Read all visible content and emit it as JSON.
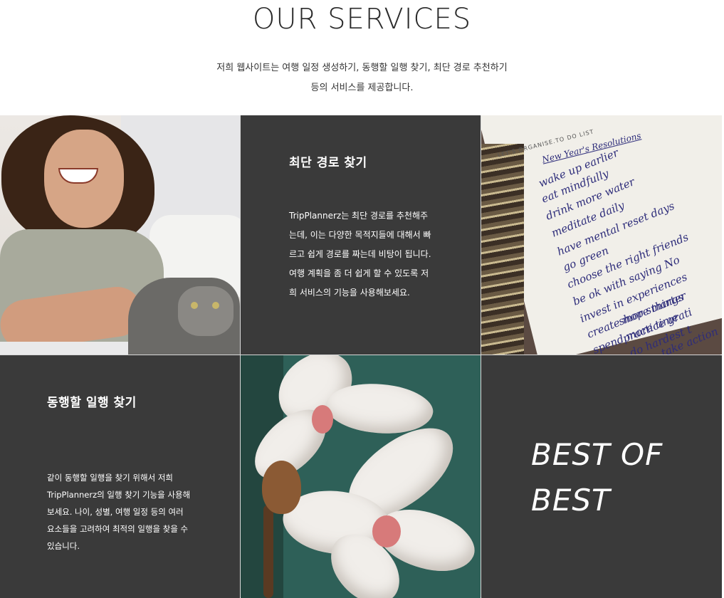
{
  "header": {
    "title": "OUR SERVICES",
    "subtitle": "저희 웹사이트는 여행 일정 생성하기, 동행할 일행 찾기, 최단 경로 추천하기 등의 서비스를 제공합니다."
  },
  "services": [
    {
      "title": "최단 경로 찾기",
      "body": "TripPlannerz는 최단 경로를 추천해주는데, 이는 다양한 목적지들에 대해서 빠르고 쉽게 경로를 짜는데 비탕이 됩니다. 여행 계획을 좀 더 쉽게 할 수 있도록 저희 서비스의 기능을 사용해보세요."
    },
    {
      "title": "동행할 일행 찾기",
      "body": "같이 동행할 일행을 찾기 위해서 저희 TripPlannerz의 일행 찾기 기능을 사용해보세요. 나이, 성별, 여행 일정 등의 여러 요소들을 고려하여 최적의 일행을 찾을 수 있습니다."
    }
  ],
  "banner": {
    "line1": "BEST OF",
    "line2": "BEST"
  },
  "notebook_photo": {
    "heading": "LET'S ORGANISE.TO DO LIST",
    "subheading": "New Year's Resolutions",
    "items": [
      "wake up earlier",
      "eat mindfully",
      "drink more water",
      "meditate daily",
      "have mental reset days",
      "go green",
      "choose the right friends",
      "be ok with saying No",
      "invest in experiences",
      "create more things",
      "spend more time",
      "shop smarter",
      "practice grati",
      "do hardest t",
      "take action"
    ]
  },
  "colors": {
    "dark_panel": "#3a3a3a",
    "page_background": "#ffffff",
    "text_light": "#ffffff",
    "teal_background": "#2e6058"
  }
}
